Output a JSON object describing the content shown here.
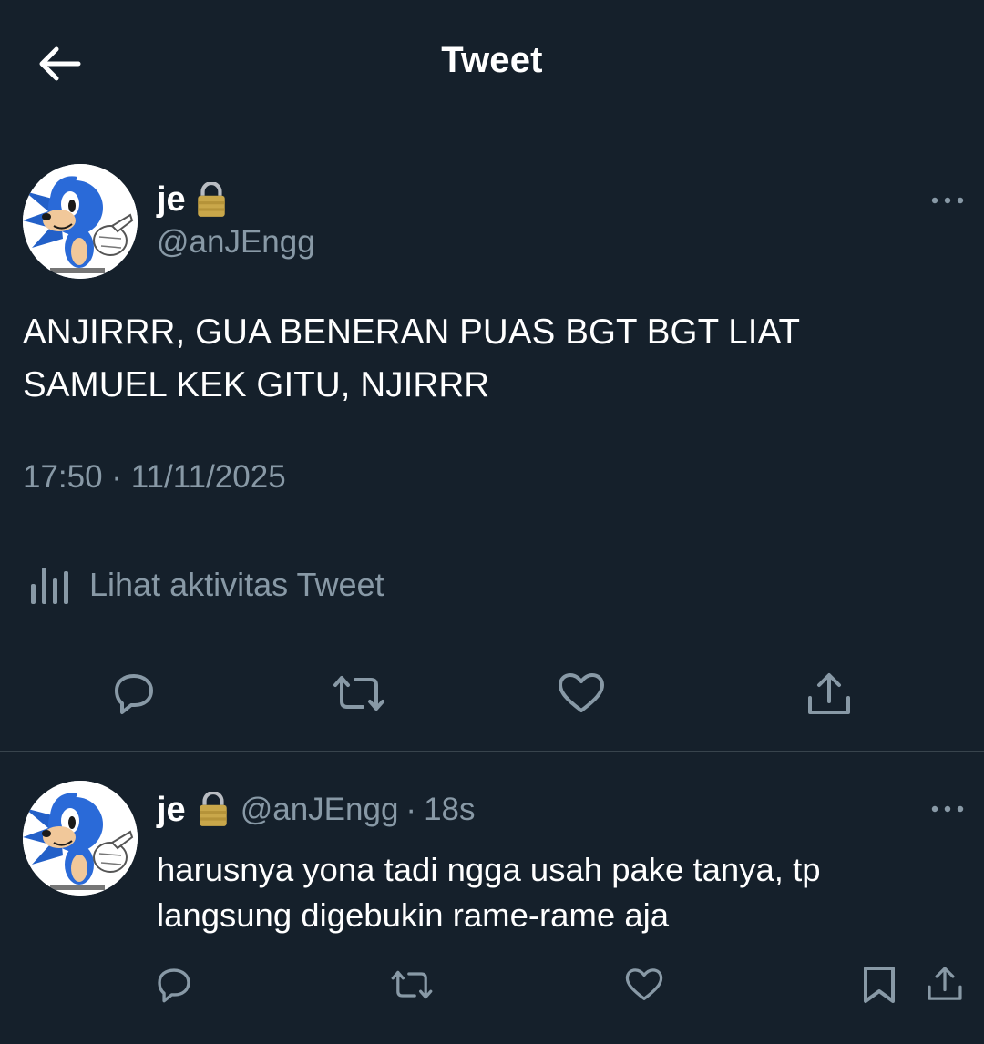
{
  "header": {
    "title": "Tweet",
    "back_icon": "arrow-left-icon"
  },
  "tweet": {
    "avatar_icon": "sonic-avatar",
    "display_name": "je",
    "lock_icon": "lock-icon",
    "handle": "@anJEngg",
    "text": "ANJIRRR, GUA BENERAN PUAS BGT BGT LIAT SAMUEL KEK GITU, NJIRRR",
    "timestamp": "17:50 · 11/11/2025",
    "activity_label": "Lihat aktivitas Tweet",
    "actions": [
      "reply-icon",
      "retweet-icon",
      "like-icon",
      "share-icon"
    ]
  },
  "reply": {
    "avatar_icon": "sonic-avatar",
    "display_name": "je",
    "lock_icon": "lock-icon",
    "handle": "@anJEngg",
    "separator": "·",
    "time": "18s",
    "text": "harusnya yona tadi ngga usah pake tanya, tp langsung digebukin rame-rame aja",
    "actions": [
      "reply-icon",
      "retweet-icon",
      "like-icon",
      "bookmark-icon",
      "share-icon"
    ]
  },
  "colors": {
    "background": "#15202b",
    "primary_text": "#ffffff",
    "secondary_text": "#8899a6",
    "icon": "#8899a6",
    "divider": "#38444d",
    "lock_gold": "#c9a74a"
  }
}
